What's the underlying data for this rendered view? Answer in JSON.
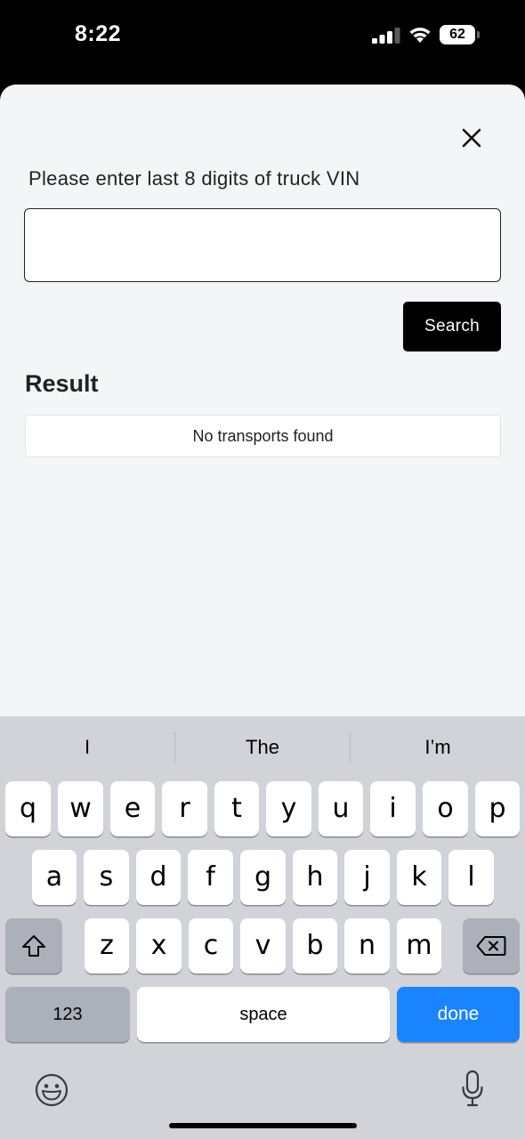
{
  "status_bar": {
    "time": "8:22",
    "battery": "62",
    "icons": [
      "cellular-signal-icon",
      "wifi-icon",
      "battery-icon"
    ]
  },
  "form": {
    "prompt": "Please enter last 8 digits of truck VIN",
    "vin_value": "",
    "search_label": "Search",
    "close_icon": "close-icon"
  },
  "result": {
    "heading": "Result",
    "message": "No transports found"
  },
  "keyboard": {
    "suggestions": [
      "I",
      "The",
      "I’m"
    ],
    "row1": [
      "q",
      "w",
      "e",
      "r",
      "t",
      "y",
      "u",
      "i",
      "o",
      "p"
    ],
    "row2": [
      "a",
      "s",
      "d",
      "f",
      "g",
      "h",
      "j",
      "k",
      "l"
    ],
    "row3": [
      "z",
      "x",
      "c",
      "v",
      "b",
      "n",
      "m"
    ],
    "numbers_label": "123",
    "space_label": "space",
    "done_label": "done",
    "accent_color": "#1a84ff",
    "icons": [
      "shift-icon",
      "backspace-icon",
      "emoji-icon",
      "microphone-icon"
    ]
  }
}
